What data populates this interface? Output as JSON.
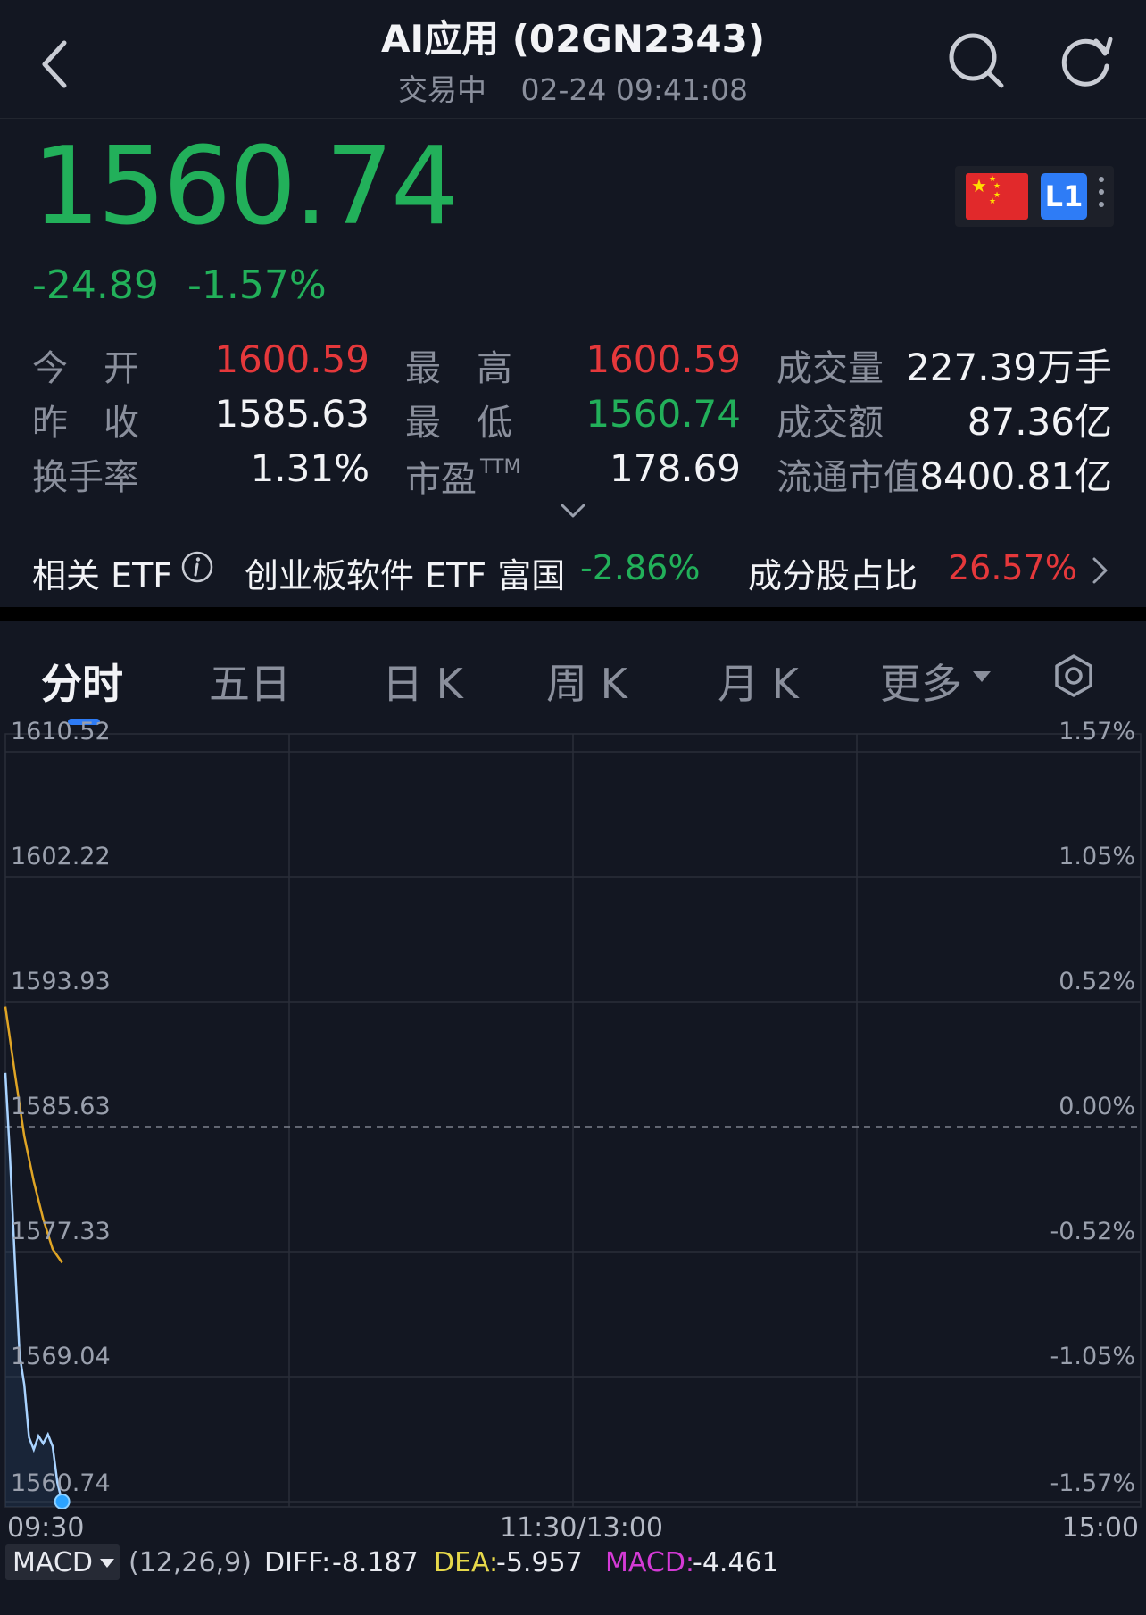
{
  "header": {
    "title": "AI应用 (02GN2343)",
    "status": "交易中",
    "datetime": "02-24 09:41:08"
  },
  "quote": {
    "price": "1560.74",
    "change": "-24.89",
    "change_pct": "-1.57%",
    "level_badge": "L1"
  },
  "stats": {
    "open_label": "今　开",
    "open": "1600.59",
    "high_label": "最　高",
    "high": "1600.59",
    "volume_label": "成交量",
    "volume": "227.39万手",
    "prev_close_label": "昨　收",
    "prev_close": "1585.63",
    "low_label": "最　低",
    "low": "1560.74",
    "amount_label": "成交额",
    "amount": "87.36亿",
    "turnover_label": "换手率",
    "turnover": "1.31%",
    "pe_label": "市盈",
    "pe_sup": "TTM",
    "pe": "178.69",
    "float_cap_label": "流通市值",
    "float_cap": "8400.81亿"
  },
  "etf": {
    "label": "相关 ETF",
    "name": "创业板软件 ETF 富国",
    "change": "-2.86%",
    "weight_label": "成分股占比",
    "weight": "26.57%"
  },
  "tabs": [
    "分时",
    "五日",
    "日 K",
    "周 K",
    "月 K",
    "更多"
  ],
  "active_tab": "分时",
  "chart_data": {
    "type": "line",
    "y_price_ticks": [
      "1610.52",
      "1602.22",
      "1593.93",
      "1585.63",
      "1577.33",
      "1569.04",
      "1560.74"
    ],
    "y_pct_ticks": [
      "1.57%",
      "1.05%",
      "0.52%",
      "0.00%",
      "-0.52%",
      "-1.05%",
      "-1.57%"
    ],
    "x_ticks": [
      "09:30",
      "11:30/13:00",
      "15:00"
    ],
    "ylim": [
      1560.74,
      1610.52
    ],
    "reference": 1585.63,
    "x_range_minutes": 240,
    "series": [
      {
        "values": [
          [
            0,
            1589.2
          ],
          [
            1,
            1583.5
          ],
          [
            2,
            1576.8
          ],
          [
            3,
            1570.5
          ],
          [
            4,
            1568.5
          ],
          [
            5,
            1565.0
          ],
          [
            6,
            1564.2
          ],
          [
            7,
            1565.1
          ],
          [
            8,
            1564.6
          ],
          [
            9,
            1565.2
          ],
          [
            10,
            1564.4
          ],
          [
            11,
            1562.0
          ],
          [
            12,
            1560.74
          ]
        ],
        "color": "#a9d3ff"
      },
      {
        "values": [
          [
            0,
            1593.6
          ],
          [
            2,
            1589.2
          ],
          [
            4,
            1585.0
          ],
          [
            6,
            1582.0
          ],
          [
            8,
            1579.5
          ],
          [
            10,
            1577.5
          ],
          [
            12,
            1576.6
          ]
        ],
        "color": "#e0a525"
      }
    ]
  },
  "macd": {
    "selector": "MACD",
    "params": "(12,26,9)",
    "diff_label": "DIFF:",
    "diff": "-8.187",
    "dea_label": "DEA:",
    "dea": "-5.957",
    "macd_label": "MACD:",
    "macd": "-4.461",
    "colors": {
      "diff": "#e8eaf0",
      "dea": "#e6d84a",
      "macd": "#d43ad6"
    }
  },
  "colors": {
    "up": "#e5383b",
    "down": "#22b05a",
    "accent": "#2e7cf6",
    "bg": "#131722"
  }
}
